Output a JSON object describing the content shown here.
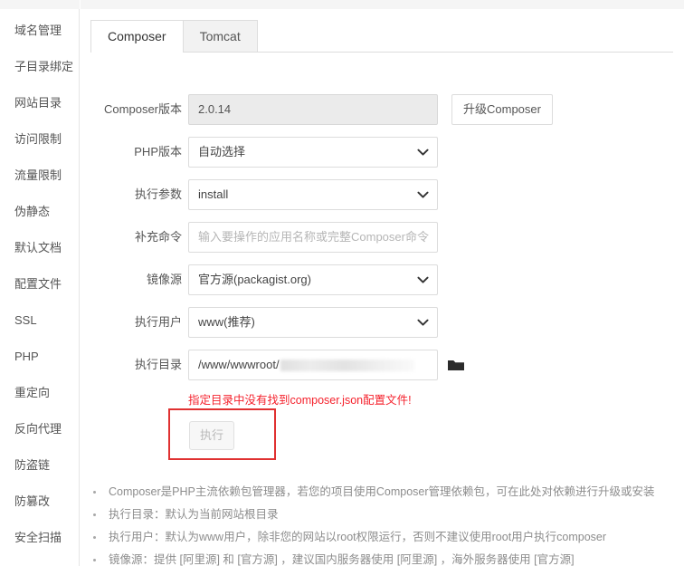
{
  "sidebar": {
    "items": [
      {
        "label": "域名管理",
        "name": "sidebar-item-domain"
      },
      {
        "label": "子目录绑定",
        "name": "sidebar-item-subdir"
      },
      {
        "label": "网站目录",
        "name": "sidebar-item-sitedir"
      },
      {
        "label": "访问限制",
        "name": "sidebar-item-access"
      },
      {
        "label": "流量限制",
        "name": "sidebar-item-traffic"
      },
      {
        "label": "伪静态",
        "name": "sidebar-item-rewrite"
      },
      {
        "label": "默认文档",
        "name": "sidebar-item-default-doc"
      },
      {
        "label": "配置文件",
        "name": "sidebar-item-config"
      },
      {
        "label": "SSL",
        "name": "sidebar-item-ssl"
      },
      {
        "label": "PHP",
        "name": "sidebar-item-php"
      },
      {
        "label": "重定向",
        "name": "sidebar-item-redirect"
      },
      {
        "label": "反向代理",
        "name": "sidebar-item-proxy"
      },
      {
        "label": "防盗链",
        "name": "sidebar-item-antileech"
      },
      {
        "label": "防篡改",
        "name": "sidebar-item-antitamper"
      },
      {
        "label": "安全扫描",
        "name": "sidebar-item-scan"
      }
    ]
  },
  "tabs": [
    {
      "label": "Composer",
      "active": true
    },
    {
      "label": "Tomcat",
      "active": false
    }
  ],
  "form": {
    "composer_version": {
      "label": "Composer版本",
      "value": "2.0.14"
    },
    "upgrade_button": {
      "label": "升级Composer"
    },
    "php_version": {
      "label": "PHP版本",
      "value": "自动选择"
    },
    "exec_param": {
      "label": "执行参数",
      "value": "install"
    },
    "extra_command": {
      "label": "补充命令",
      "value": "",
      "placeholder": "输入要操作的应用名称或完整Composer命令"
    },
    "mirror_source": {
      "label": "镜像源",
      "value": "官方源(packagist.org)"
    },
    "exec_user": {
      "label": "执行用户",
      "value": "www(推荐)"
    },
    "exec_dir": {
      "label": "执行目录",
      "value": "/www/wwwroot/"
    }
  },
  "error_message": "指定目录中没有找到composer.json配置文件!",
  "execute_button": {
    "label": "执行"
  },
  "notes": [
    "Composer是PHP主流依赖包管理器，若您的项目使用Composer管理依赖包，可在此处对依赖进行升级或安装",
    "执行目录：默认为当前网站根目录",
    "执行用户：默认为www用户，除非您的网站以root权限运行，否则不建议使用root用户执行composer",
    "镜像源：提供 [阿里源] 和 [官方源] ，建议国内服务器使用 [阿里源] ，海外服务器使用 [官方源]"
  ],
  "colors": {
    "error_red": "#f5222d",
    "highlight_red": "#e03131",
    "text": "#555555"
  }
}
